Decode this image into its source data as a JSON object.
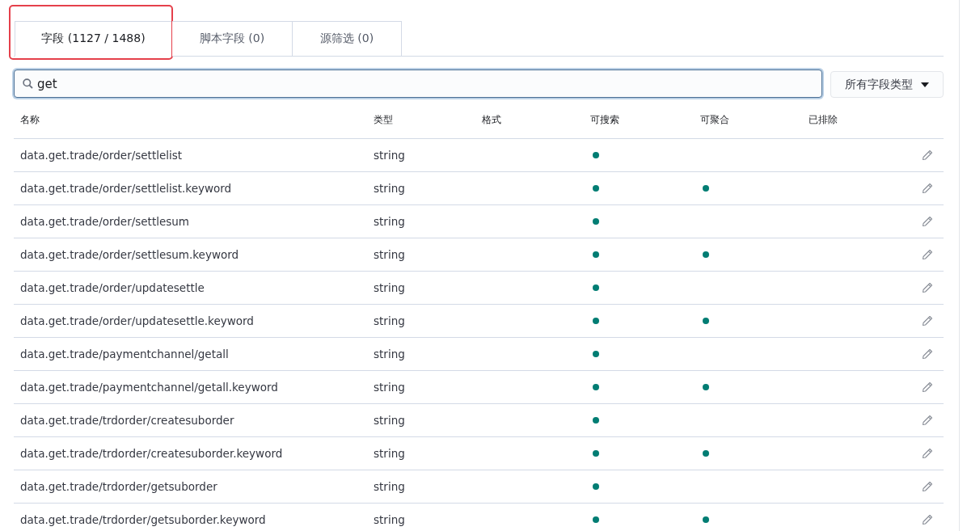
{
  "tabs": [
    {
      "label": "字段 (1127 / 1488)",
      "selected": true,
      "highlighted": true
    },
    {
      "label": "脚本字段 (0)",
      "selected": false,
      "highlighted": false
    },
    {
      "label": "源筛选 (0)",
      "selected": false,
      "highlighted": false
    }
  ],
  "search": {
    "value": "get"
  },
  "type_filter": {
    "label": "所有字段类型"
  },
  "table": {
    "columns": [
      "名称",
      "类型",
      "格式",
      "可搜索",
      "可聚合",
      "已排除"
    ],
    "rows": [
      {
        "name": "data.get.trade/order/settlelist",
        "type": "string",
        "searchable": true,
        "aggregatable": false
      },
      {
        "name": "data.get.trade/order/settlelist.keyword",
        "type": "string",
        "searchable": true,
        "aggregatable": true
      },
      {
        "name": "data.get.trade/order/settlesum",
        "type": "string",
        "searchable": true,
        "aggregatable": false
      },
      {
        "name": "data.get.trade/order/settlesum.keyword",
        "type": "string",
        "searchable": true,
        "aggregatable": true
      },
      {
        "name": "data.get.trade/order/updatesettle",
        "type": "string",
        "searchable": true,
        "aggregatable": false
      },
      {
        "name": "data.get.trade/order/updatesettle.keyword",
        "type": "string",
        "searchable": true,
        "aggregatable": true
      },
      {
        "name": "data.get.trade/paymentchannel/getall",
        "type": "string",
        "searchable": true,
        "aggregatable": false
      },
      {
        "name": "data.get.trade/paymentchannel/getall.keyword",
        "type": "string",
        "searchable": true,
        "aggregatable": true
      },
      {
        "name": "data.get.trade/trdorder/createsuborder",
        "type": "string",
        "searchable": true,
        "aggregatable": false
      },
      {
        "name": "data.get.trade/trdorder/createsuborder.keyword",
        "type": "string",
        "searchable": true,
        "aggregatable": true
      },
      {
        "name": "data.get.trade/trdorder/getsuborder",
        "type": "string",
        "searchable": true,
        "aggregatable": false
      },
      {
        "name": "data.get.trade/trdorder/getsuborder.keyword",
        "type": "string",
        "searchable": true,
        "aggregatable": true
      }
    ]
  }
}
